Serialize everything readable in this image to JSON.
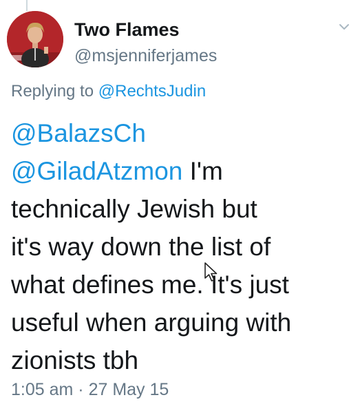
{
  "tweet": {
    "author": {
      "name": "Two Flames",
      "handle": "@msjenniferjames"
    },
    "reply": {
      "prefix": "Replying to ",
      "mention": "@RechtsJudin"
    },
    "body": {
      "mention_1": "@BalazsCh",
      "mention_2": "@GiladAtzmon",
      "line_1_rest": " I'm",
      "line_2": "technically Jewish but",
      "line_3": "it's way down the list of",
      "line_4": "what defines me. It's just",
      "line_5": "useful when arguing with",
      "line_6": "zionists tbh"
    },
    "timestamp": {
      "time": "1:05 am",
      "separator": " · ",
      "date": "27 May 15"
    }
  },
  "icons": {
    "menu": "chevron-down-icon",
    "cursor": "mouse-pointer-icon",
    "avatar": "profile-photo"
  },
  "colors": {
    "link": "#1b95e0",
    "text": "#14171a",
    "secondary": "#657786",
    "avatar_bg": "#b3262a"
  }
}
